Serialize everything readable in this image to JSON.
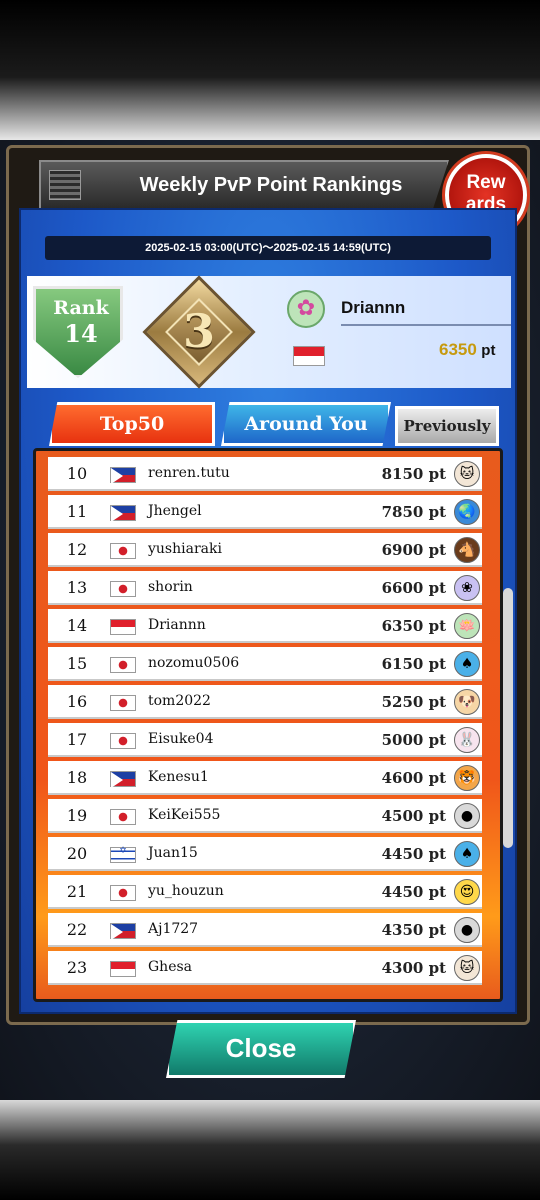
{
  "header": {
    "title": "Weekly PvP Point Rankings",
    "rewards_label": "Rew ards",
    "date_range": "2025-02-15 03:00(UTC)〜2025-02-15 14:59(UTC)"
  },
  "player": {
    "rank_label": "Rank",
    "rank": "14",
    "badge_number": "3",
    "name": "Driannn",
    "country": "Indonesia",
    "points": "6350",
    "points_unit": "pt",
    "avatar_icon": "lotus-icon"
  },
  "tabs": [
    {
      "label": "Top50",
      "active": true
    },
    {
      "label": "Around You",
      "active": false
    },
    {
      "label": "Previously",
      "active": false
    }
  ],
  "rankings": [
    {
      "rank": "10",
      "flag": "ph",
      "name": "renren.tutu",
      "points": "8150 pt",
      "avatar": "cat-icon"
    },
    {
      "rank": "11",
      "flag": "ph",
      "name": "Jhengel",
      "points": "7850 pt",
      "avatar": "globe-icon"
    },
    {
      "rank": "12",
      "flag": "jp",
      "name": "yushiaraki",
      "points": "6900 pt",
      "avatar": "horse-icon"
    },
    {
      "rank": "13",
      "flag": "jp",
      "name": "shorin",
      "points": "6600 pt",
      "avatar": "hydrangea-icon"
    },
    {
      "rank": "14",
      "flag": "id",
      "name": "Driannn",
      "points": "6350 pt",
      "avatar": "lotus-icon"
    },
    {
      "rank": "15",
      "flag": "jp",
      "name": "nozomu0506",
      "points": "6150 pt",
      "avatar": "spade-icon"
    },
    {
      "rank": "16",
      "flag": "jp",
      "name": "tom2022",
      "points": "5250 pt",
      "avatar": "dog-icon"
    },
    {
      "rank": "17",
      "flag": "jp",
      "name": "Eisuke04",
      "points": "5000 pt",
      "avatar": "rabbit-icon"
    },
    {
      "rank": "18",
      "flag": "ph",
      "name": "Kenesu1",
      "points": "4600 pt",
      "avatar": "tiger-icon"
    },
    {
      "rank": "19",
      "flag": "jp",
      "name": "KeiKei555",
      "points": "4500 pt",
      "avatar": "default-avatar-icon"
    },
    {
      "rank": "20",
      "flag": "il",
      "name": "Juan15",
      "points": "4450 pt",
      "avatar": "spade-icon"
    },
    {
      "rank": "21",
      "flag": "jp",
      "name": "yu_houzun",
      "points": "4450 pt",
      "avatar": "emoji-icon"
    },
    {
      "rank": "22",
      "flag": "ph",
      "name": "Aj1727",
      "points": "4350 pt",
      "avatar": "default-avatar-icon"
    },
    {
      "rank": "23",
      "flag": "id",
      "name": "Ghesa",
      "points": "4300 pt",
      "avatar": "cat-icon"
    }
  ],
  "avatar_glyphs": {
    "cat-icon": "🐱",
    "globe-icon": "🌏",
    "horse-icon": "🐴",
    "hydrangea-icon": "❀",
    "lotus-icon": "🪷",
    "spade-icon": "♠",
    "dog-icon": "🐶",
    "rabbit-icon": "🐰",
    "tiger-icon": "🐯",
    "default-avatar-icon": "●",
    "emoji-icon": "😍"
  },
  "avatar_colors": {
    "cat-icon": "#f3e6d6",
    "globe-icon": "#3a8ad8",
    "horse-icon": "#6a3c1c",
    "hydrangea-icon": "#c9c1f2",
    "lotus-icon": "#bde4b9",
    "spade-icon": "#4ab0e8",
    "dog-icon": "#f6d6a6",
    "rabbit-icon": "#f7e4ee",
    "tiger-icon": "#f3a64a",
    "default-avatar-icon": "#d9d9d9",
    "emoji-icon": "#ffd84a"
  },
  "close_label": "Close"
}
